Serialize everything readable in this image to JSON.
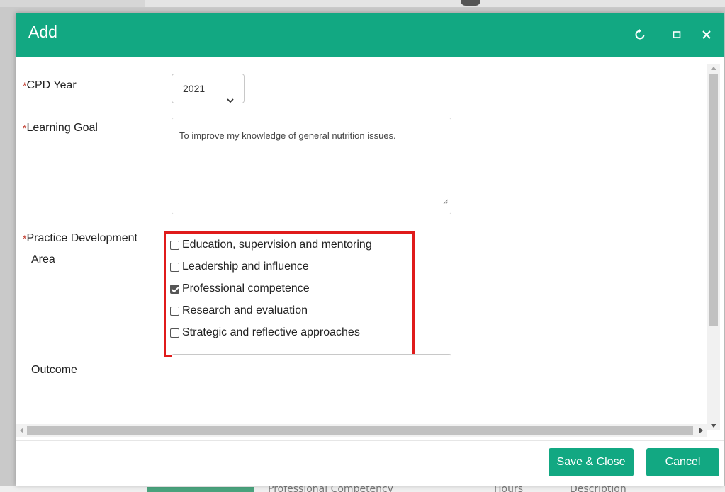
{
  "dialog": {
    "title": "Add",
    "controls": [
      "refresh-icon",
      "maximize-icon",
      "close-icon"
    ]
  },
  "form": {
    "required_marker": "*",
    "cpd_year": {
      "label": "CPD Year",
      "value": "2021"
    },
    "learning_goal": {
      "label": "Learning Goal",
      "value": "To improve my knowledge of general nutrition issues."
    },
    "practice_area": {
      "label_line1": "Practice Development",
      "label_line2": "Area",
      "options": [
        {
          "label": "Education, supervision and mentoring",
          "checked": false
        },
        {
          "label": "Leadership and influence",
          "checked": false
        },
        {
          "label": "Professional competence",
          "checked": true
        },
        {
          "label": "Research and evaluation",
          "checked": false
        },
        {
          "label": "Strategic and reflective approaches",
          "checked": false
        }
      ]
    },
    "outcome": {
      "label": "Outcome",
      "value": ""
    }
  },
  "footer": {
    "save_label": "Save & Close",
    "cancel_label": "Cancel"
  },
  "background": {
    "row_text_1": "Professional Competency",
    "row_text_2": "Hours",
    "row_text_3": "Description"
  },
  "colors": {
    "accent": "#12a882",
    "highlight": "#e01b1b",
    "required": "#c0392b"
  }
}
